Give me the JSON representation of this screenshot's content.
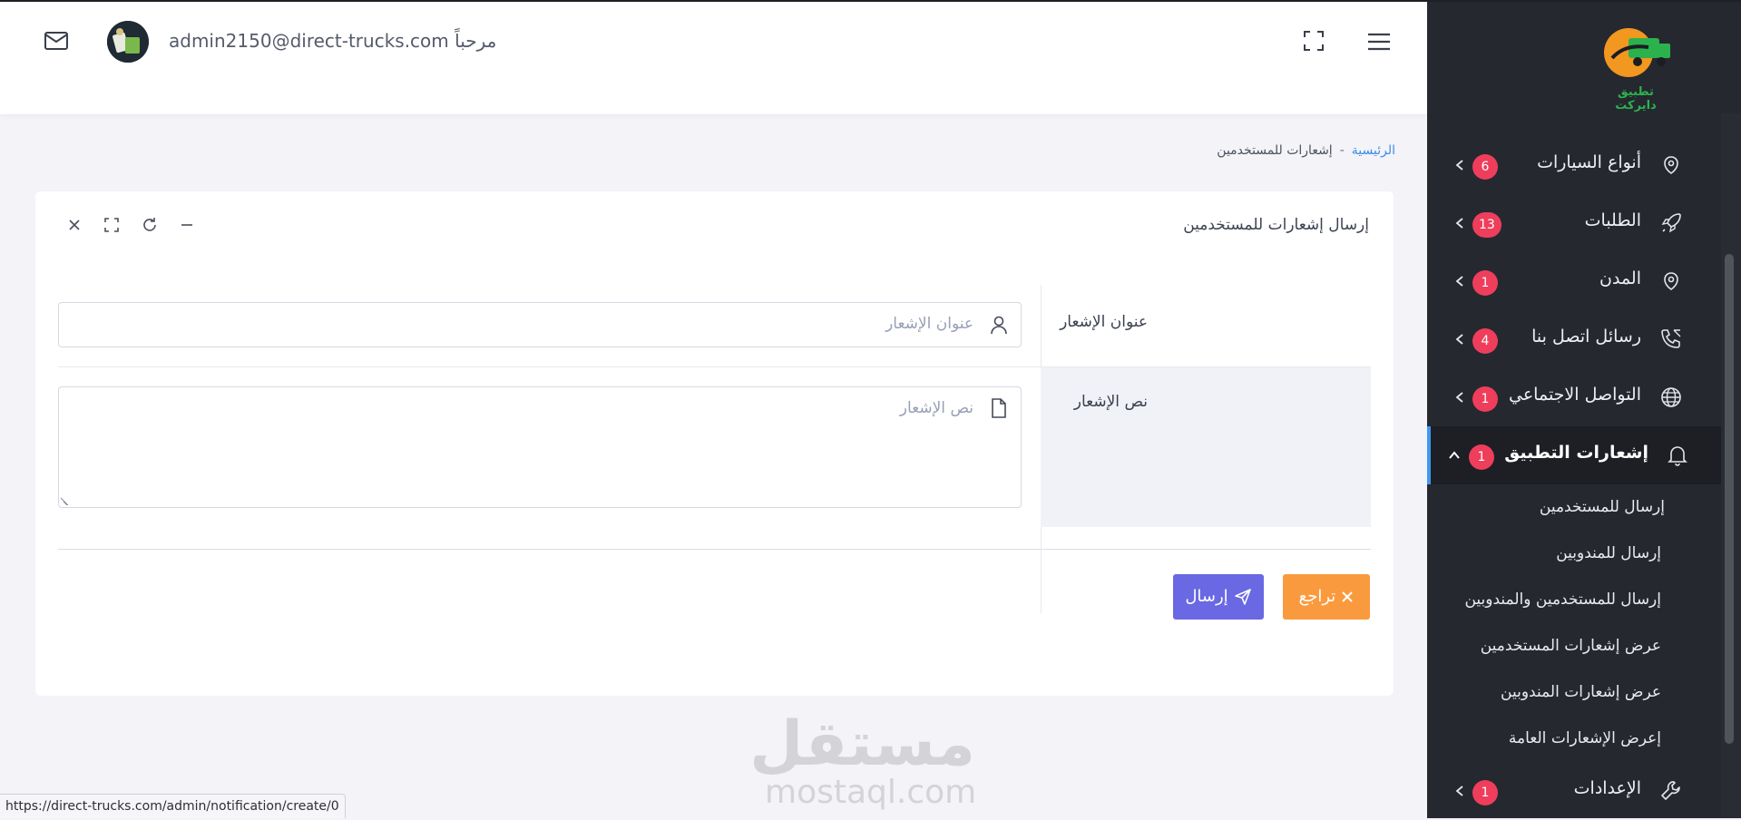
{
  "header": {
    "greeting": "admin2150@direct-trucks.com مرحباً",
    "icons": [
      "mail-icon",
      "avatar",
      "fullscreen-icon",
      "hamburger-menu-icon"
    ]
  },
  "sidebar": {
    "logo_text": "تطبيق دايركت",
    "items": [
      {
        "label": "أنواع السيارات",
        "badge": "6",
        "icon": "car-icon"
      },
      {
        "label": "الطلبات",
        "badge": "13",
        "icon": "rocket-icon"
      },
      {
        "label": "المدن",
        "badge": "1",
        "icon": "city-icon"
      },
      {
        "label": "رسائل اتصل بنا",
        "badge": "4",
        "icon": "phone-call-icon"
      },
      {
        "label": "التواصل الاجتماعي",
        "badge": "1",
        "icon": "globe-icon"
      },
      {
        "label": "إشعارات التطبيق",
        "badge": "1",
        "icon": "bell-icon"
      },
      {
        "label": "الإعدادات",
        "badge": "1",
        "icon": "wrench-icon"
      }
    ],
    "sub_items": [
      "إرسال للمستخدمين",
      "إرسال للمندوبين",
      "إرسال للمستخدمين والمندوبين",
      "عرض إشعارات المستخدمين",
      "عرض إشعارات المندوبين",
      "إعرض الإشعارات العامة"
    ]
  },
  "breadcrumb": {
    "home": "الرئيسية",
    "separator": "-",
    "current": "إشعارات للمستخدمين"
  },
  "card": {
    "title": "إرسال إشعارات للمستخدمين",
    "fields": {
      "title_label": "عنوان الإشعار",
      "title_placeholder": "عنوان الإشعار",
      "body_label": "نص الإشعار",
      "body_placeholder": "نص الإشعار"
    },
    "buttons": {
      "send": "إرسال",
      "back": "تراجع"
    }
  },
  "watermark": {
    "arabic": "مستقل",
    "latin": "mostaql.com"
  },
  "status_url": "https://direct-trucks.com/admin/notification/create/0",
  "colors": {
    "sidebar_bg": "#262830",
    "badge": "#ee3e5b",
    "send_button": "#6a68e2",
    "back_button": "#fa9a3e",
    "link": "#3c8ee8",
    "active_indicator": "#4196ef"
  }
}
